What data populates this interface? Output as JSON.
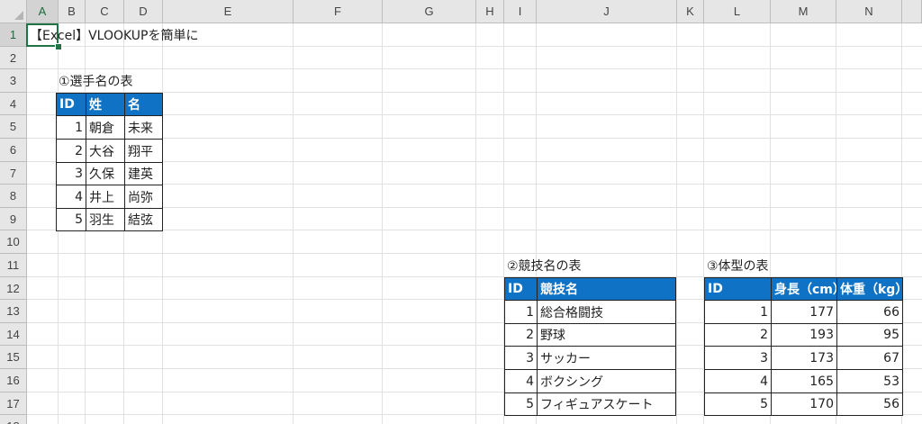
{
  "columns": [
    "A",
    "B",
    "C",
    "D",
    "E",
    "F",
    "G",
    "H",
    "I",
    "J",
    "K",
    "L",
    "M",
    "N"
  ],
  "rows": [
    "1",
    "2",
    "3",
    "4",
    "5",
    "6",
    "7",
    "8",
    "9",
    "10",
    "11",
    "12",
    "13",
    "14",
    "15",
    "16",
    "17",
    "18"
  ],
  "title": "【Excel】VLOOKUPを簡単に",
  "table1": {
    "caption": "①選手名の表",
    "headers": [
      "ID",
      "姓",
      "名"
    ],
    "rows": [
      [
        "1",
        "朝倉",
        "未来"
      ],
      [
        "2",
        "大谷",
        "翔平"
      ],
      [
        "3",
        "久保",
        "建英"
      ],
      [
        "4",
        "井上",
        "尚弥"
      ],
      [
        "5",
        "羽生",
        "結弦"
      ]
    ]
  },
  "table2": {
    "caption": "②競技名の表",
    "headers": [
      "ID",
      "競技名"
    ],
    "rows": [
      [
        "1",
        "総合格闘技"
      ],
      [
        "2",
        "野球"
      ],
      [
        "3",
        "サッカー"
      ],
      [
        "4",
        "ボクシング"
      ],
      [
        "5",
        "フィギュアスケート"
      ]
    ]
  },
  "table3": {
    "caption": "③体型の表",
    "headers": [
      "ID",
      "身長（cm）",
      "体重（kg）"
    ],
    "rows": [
      [
        "1",
        "177",
        "66"
      ],
      [
        "2",
        "193",
        "95"
      ],
      [
        "3",
        "173",
        "67"
      ],
      [
        "4",
        "165",
        "53"
      ],
      [
        "5",
        "170",
        "56"
      ]
    ]
  },
  "selected_cell": "A1",
  "colors": {
    "header_fill": "#0f72c4",
    "selection": "#217346"
  }
}
